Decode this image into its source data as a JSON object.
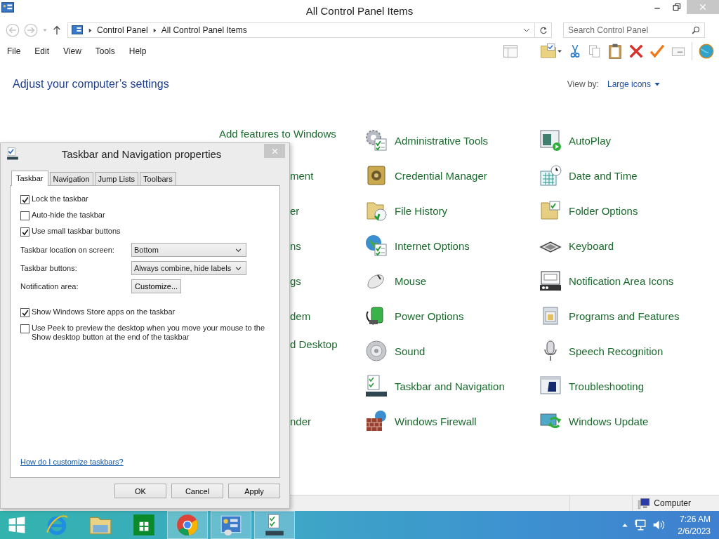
{
  "window": {
    "title": "All Control Panel Items"
  },
  "address_bar": {
    "breadcrumbs": [
      "Control Panel",
      "All Control Panel Items"
    ]
  },
  "search": {
    "placeholder": "Search Control Panel"
  },
  "menu": [
    "File",
    "Edit",
    "View",
    "Tools",
    "Help"
  ],
  "header": {
    "title": "Adjust your computer’s settings",
    "view_by_label": "View by:",
    "view_by_value": "Large icons"
  },
  "rows": [
    {
      "column_2": {
        "label": "Add features to Windows",
        "kind": "text",
        "wrapped": true
      },
      "column_3": {
        "label": "Administrative Tools",
        "kind": "full",
        "wrapped": false
      },
      "column_4": {
        "label": "AutoPlay",
        "kind": "full",
        "wrapped": false
      }
    },
    {
      "column_2": {
        "label": "ment",
        "kind": "partial",
        "wrapped": false
      },
      "column_3": {
        "label": "Credential Manager",
        "kind": "full",
        "wrapped": false
      },
      "column_4": {
        "label": "Date and Time",
        "kind": "full",
        "wrapped": false
      }
    },
    {
      "column_2": {
        "label": "er",
        "kind": "partial",
        "wrapped": false
      },
      "column_3": {
        "label": "File History",
        "kind": "full",
        "wrapped": false
      },
      "column_4": {
        "label": "Folder Options",
        "kind": "full",
        "wrapped": false
      }
    },
    {
      "column_2": {
        "label": "ns",
        "kind": "partial",
        "wrapped": false
      },
      "column_3": {
        "label": "Internet Options",
        "kind": "full",
        "wrapped": false
      },
      "column_4": {
        "label": "Keyboard",
        "kind": "full",
        "wrapped": false
      }
    },
    {
      "column_2": {
        "label": "gs",
        "kind": "partial",
        "wrapped": false
      },
      "column_3": {
        "label": "Mouse",
        "kind": "full",
        "wrapped": false
      },
      "column_4": {
        "label": "Notification Area Icons",
        "kind": "full",
        "wrapped": false
      }
    },
    {
      "column_2": {
        "label": "dem",
        "kind": "partial",
        "wrapped": false
      },
      "column_3": {
        "label": "Power Options",
        "kind": "full",
        "wrapped": false
      },
      "column_4": {
        "label": "Programs and Features",
        "kind": "full",
        "wrapped": false
      }
    },
    {
      "column_2": {
        "label": "d Desktop",
        "kind": "partial",
        "wrapped": true
      },
      "column_3": {
        "label": "Sound",
        "kind": "full",
        "wrapped": false
      },
      "column_4": {
        "label": "Speech Recognition",
        "kind": "full",
        "wrapped": false
      }
    },
    {
      "column_3": {
        "label": "Taskbar and Navigation",
        "kind": "full",
        "wrapped": false
      },
      "column_4": {
        "label": "Troubleshooting",
        "kind": "full",
        "wrapped": false
      }
    },
    {
      "column_2": {
        "label": "nder",
        "kind": "partial",
        "wrapped": false
      },
      "column_3": {
        "label": "Windows Firewall",
        "kind": "full",
        "wrapped": false
      },
      "column_4": {
        "label": "Windows Update",
        "kind": "full",
        "wrapped": false
      }
    }
  ],
  "status_bar": {
    "location": "Computer"
  },
  "dialog": {
    "title": "Taskbar and Navigation properties",
    "tabs": [
      {
        "label": "Taskbar",
        "selected": true
      },
      {
        "label": "Navigation",
        "selected": false
      },
      {
        "label": "Jump Lists",
        "selected": false
      },
      {
        "label": "Toolbars",
        "selected": false
      }
    ],
    "items": [
      {
        "kind": "checkbox",
        "label": "Lock the taskbar",
        "checked": true
      },
      {
        "kind": "checkbox",
        "label": "Auto-hide the taskbar",
        "checked": false
      },
      {
        "kind": "checkbox",
        "label": "Use small taskbar buttons",
        "checked": true
      },
      {
        "kind": "dropdown",
        "label": "Taskbar location on screen:",
        "value": "Bottom"
      },
      {
        "kind": "dropdown",
        "label": "Taskbar buttons:",
        "value": "Always combine, hide labels"
      },
      {
        "kind": "button",
        "label": "Notification area:",
        "value": "Customize..."
      },
      {
        "kind": "checkbox",
        "label": "Show Windows Store apps on the taskbar",
        "checked": true
      },
      {
        "kind": "checkbox",
        "label": "Use Peek to preview the desktop when you move your mouse to the Show desktop button at the end of the taskbar",
        "checked": false
      }
    ],
    "help_link": "How do I customize taskbars?",
    "buttons": [
      "OK",
      "Cancel",
      "Apply"
    ]
  },
  "taskbar": {
    "apps": [
      {
        "running": false
      },
      {
        "running": false
      },
      {
        "running": false
      },
      {
        "running": true
      },
      {
        "running": true
      },
      {
        "running": true
      }
    ],
    "time": "7:26 AM",
    "date": "2/6/2023"
  }
}
